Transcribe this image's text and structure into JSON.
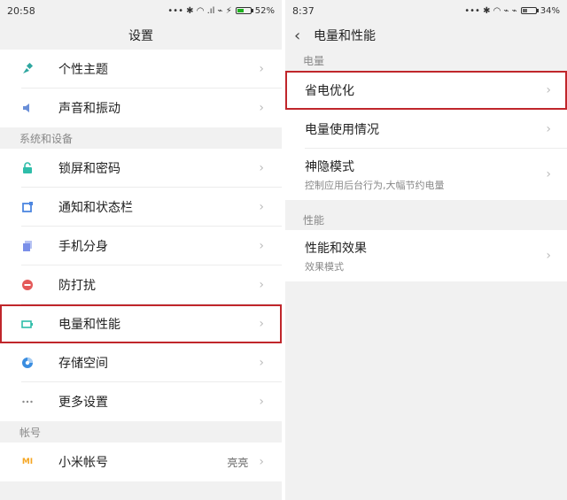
{
  "left": {
    "status": {
      "time": "20:58",
      "icons": "••• ✱ ◠ .ıl ⌁ ⚡",
      "battery": "52%",
      "battery_level": 0.52
    },
    "title": "设置",
    "top_items": [
      {
        "label": "个性主题",
        "icon": "theme-icon",
        "color": "#2fa7a0"
      },
      {
        "label": "声音和振动",
        "icon": "speaker-icon",
        "color": "#6a8fd8"
      }
    ],
    "section_system": "系统和设备",
    "system_items": [
      {
        "label": "锁屏和密码",
        "icon": "lock-icon",
        "color": "#2fbda9"
      },
      {
        "label": "通知和状态栏",
        "icon": "notification-icon",
        "color": "#4d86e0"
      },
      {
        "label": "手机分身",
        "icon": "clone-icon",
        "color": "#7a8fe8"
      },
      {
        "label": "防打扰",
        "icon": "do-not-disturb-icon",
        "color": "#e45a5a"
      },
      {
        "label": "电量和性能",
        "icon": "battery-icon",
        "color": "#2fbda9",
        "highlighted": true
      },
      {
        "label": "存储空间",
        "icon": "storage-icon",
        "color": "#3a8de0"
      },
      {
        "label": "更多设置",
        "icon": "more-icon",
        "color": "#8a8a8a"
      }
    ],
    "section_account": "帐号",
    "account_item": {
      "label": "小米帐号",
      "value": "亮亮",
      "icon": "mi-logo-icon",
      "icon_text": "MI",
      "color": "#f5a623"
    }
  },
  "right": {
    "status": {
      "time": "8:37",
      "icons": "••• ✱ ◠ ⌁ ⌁",
      "battery": "34%",
      "battery_level": 0.34
    },
    "back": "‹",
    "title": "电量和性能",
    "section_power": "电量",
    "power_items": [
      {
        "label": "省电优化",
        "highlighted": true
      },
      {
        "label": "电量使用情况"
      },
      {
        "label": "神隐模式",
        "sub": "控制应用后台行为,大幅节约电量"
      }
    ],
    "section_perf": "性能",
    "perf_items": [
      {
        "label": "性能和效果",
        "sub": "效果模式"
      }
    ]
  },
  "chevron": "›"
}
